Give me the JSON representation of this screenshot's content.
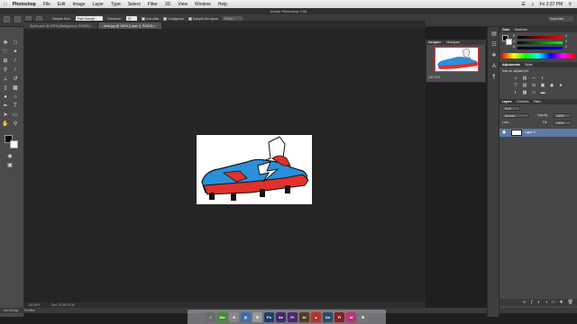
{
  "menubar": {
    "app_name": "Photoshop",
    "menus": [
      "File",
      "Edit",
      "Image",
      "Layer",
      "Type",
      "Select",
      "Filter",
      "3D",
      "View",
      "Window",
      "Help"
    ],
    "clock": "Fri 2:37 PM"
  },
  "window_title": "Adobe Photoshop CS6",
  "options": {
    "sample_size_label": "Sample Size:",
    "sample_size_value": "Point Sample",
    "tolerance_label": "Tolerance:",
    "tolerance_value": "32",
    "antialias_label": "Anti-alias",
    "contiguous_label": "Contiguous",
    "sample_all_layers_label": "Sample All Layers",
    "refine_edge_label": "Refine Edge...",
    "workspace": "Essentials"
  },
  "tabs": [
    {
      "label": "Sports.psd @ 100% (Background, RGB/8) ×",
      "active": false
    },
    {
      "label": "cleat.jpg @ 150% (Layer 0, RGB/8) ×",
      "active": true
    }
  ],
  "status": {
    "zoom": "150.15%",
    "doc": "Doc: 75.3K/75.3K"
  },
  "minibridge": {
    "tab1": "Mini Bridge",
    "tab2": "Timeline"
  },
  "navigator": {
    "tab1": "Navigator",
    "tab2": "Histogram",
    "zoom": "150.15%"
  },
  "color_panel": {
    "tab1": "Color",
    "tab2": "Swatches",
    "r_label": "R",
    "g_label": "G",
    "b_label": "B",
    "r_value": "0",
    "g_value": "0",
    "b_value": "0"
  },
  "adjustments_panel": {
    "tab1": "Adjustments",
    "tab2": "Styles",
    "title": "Add an adjustment"
  },
  "layers_panel": {
    "tab1": "Layers",
    "tab2": "Channels",
    "tab3": "Paths",
    "kind_label": "Kind",
    "blend_mode": "Normal",
    "opacity_label": "Opacity:",
    "opacity_value": "100%",
    "lock_label": "Lock:",
    "fill_label": "Fill:",
    "fill_value": "100%",
    "layer_name": "Layer 0"
  },
  "dock_apps": [
    "Dw",
    "Ps",
    "Ae",
    "Pr",
    "Ai",
    "An",
    "Fl",
    "Id"
  ],
  "colors": {
    "accent_blue": "#2a8fdb",
    "accent_red": "#e0312b"
  }
}
